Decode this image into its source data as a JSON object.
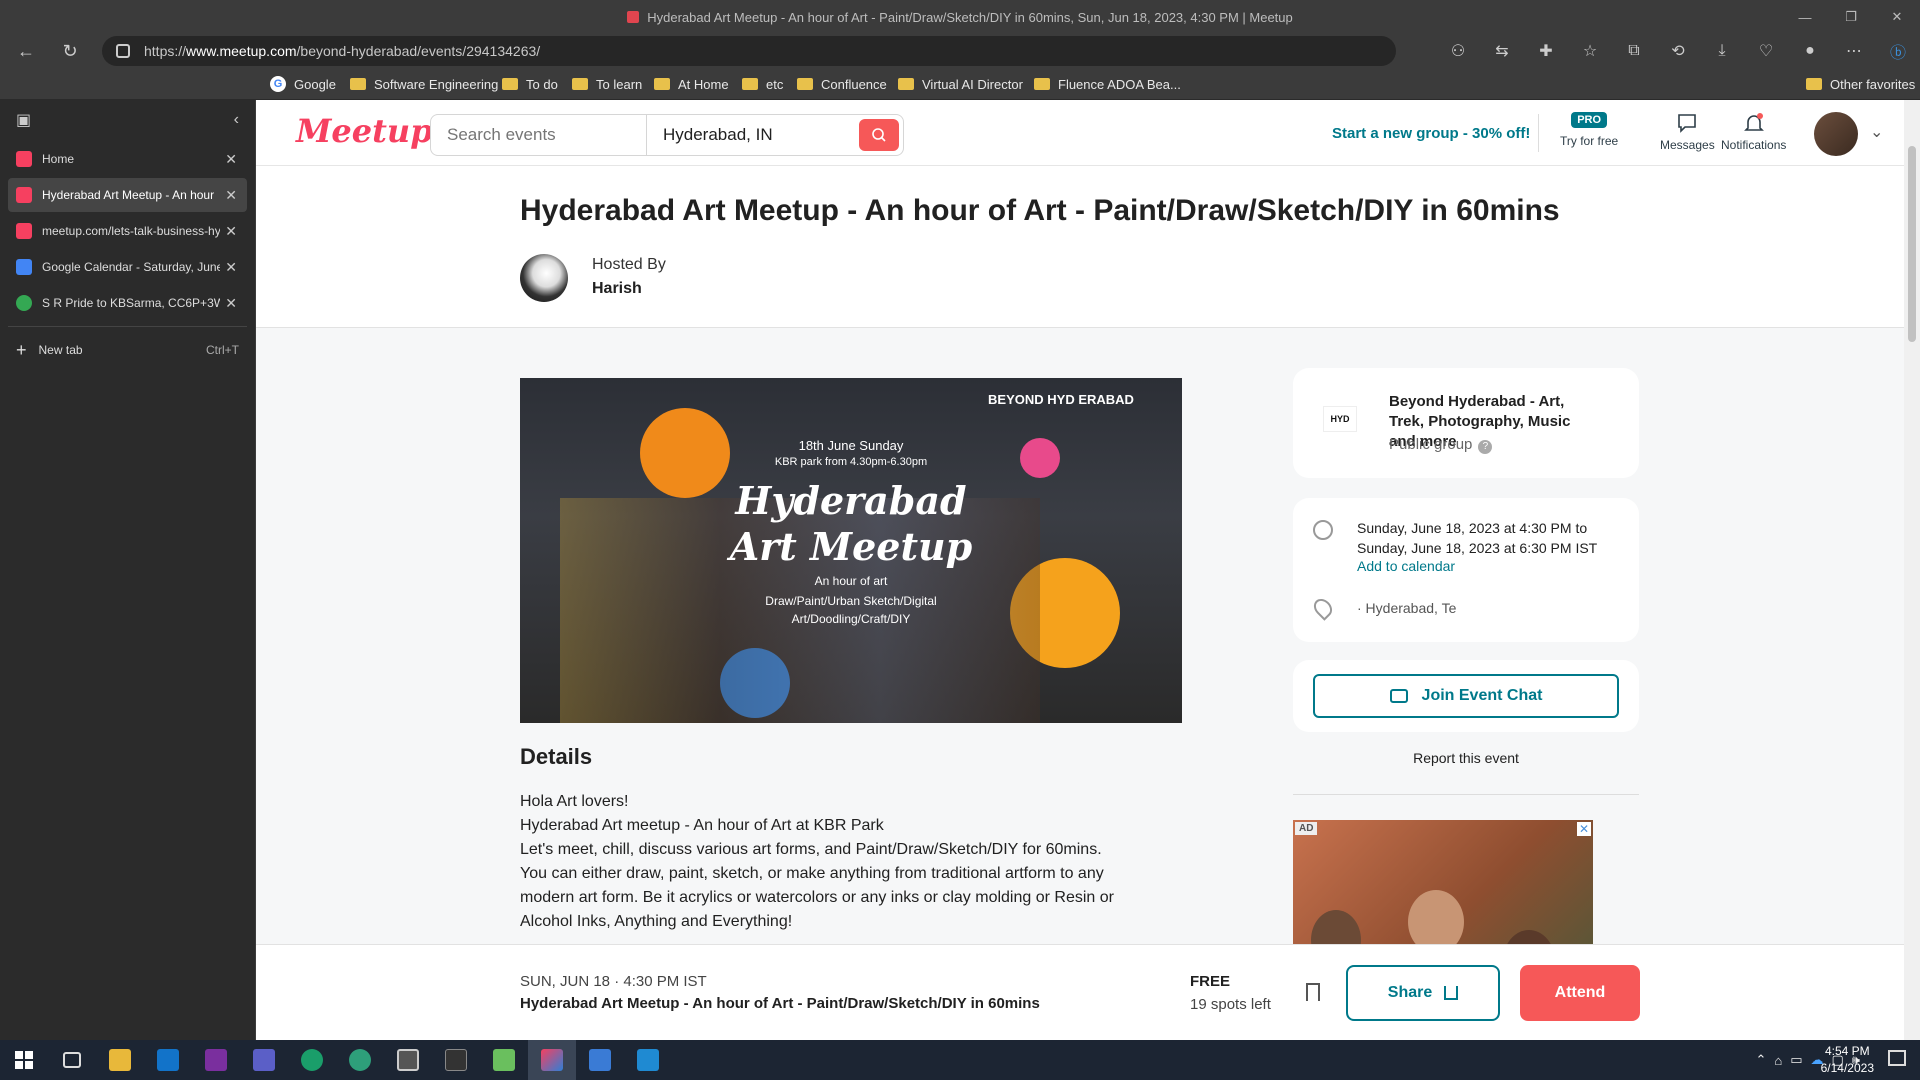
{
  "browser": {
    "window_title": "Hyderabad Art Meetup - An hour of Art - Paint/Draw/Sketch/DIY in 60mins, Sun, Jun 18, 2023, 4:30 PM | Meetup",
    "url_prefix": "https://",
    "url_host": "www.meetup.com",
    "url_path": "/beyond-hyderabad/events/294134263/",
    "bookmarks": [
      "Google",
      "Software Engineering",
      "To do",
      "To learn",
      "At Home",
      "etc",
      "Confluence",
      "Virtual AI Director",
      "Fluence ADOA Bea...",
      "Other favorites"
    ]
  },
  "tabs": {
    "items": [
      {
        "label": "Home",
        "icon": "meetup-icon",
        "color": "#f64060"
      },
      {
        "label": "Hyderabad Art Meetup - An hour",
        "icon": "meetup-icon",
        "color": "#f64060"
      },
      {
        "label": "meetup.com/lets-talk-business-hy",
        "icon": "meetup-icon",
        "color": "#f64060"
      },
      {
        "label": "Google Calendar - Saturday, June",
        "icon": "calendar-icon",
        "color": "#4285f4"
      },
      {
        "label": "S R Pride to KBSarma, CC6P+3W5",
        "icon": "maps-icon",
        "color": "#34a853"
      }
    ],
    "new_tab_label": "New tab",
    "new_tab_shortcut": "Ctrl+T"
  },
  "header": {
    "logo": "Meetup",
    "search_placeholder": "Search events",
    "location_value": "Hyderabad, IN",
    "start_group": "Start a new group - 30% off!",
    "pro_badge": "PRO",
    "try_free": "Try for free",
    "messages": "Messages",
    "notifications": "Notifications"
  },
  "event": {
    "title": "Hyderabad Art Meetup - An hour of Art - Paint/Draw/Sketch/DIY in 60mins",
    "hosted_by": "Hosted By",
    "host_name": "Harish",
    "image_text": {
      "brand": "BEYOND HYD ERABAD",
      "date_line": "18th June Sunday",
      "venue_line": "KBR park from 4.30pm-6.30pm",
      "headline1": "Hyderabad",
      "headline2": "Art Meetup",
      "sub1": "An hour of art",
      "sub2": "Draw/Paint/Urban Sketch/Digital",
      "sub3": "Art/Doodling/Craft/DIY"
    },
    "details_heading": "Details",
    "details_lines": [
      "Hola Art lovers!",
      "Hyderabad Art meetup - An hour of Art at KBR Park",
      "Let's meet, chill, discuss various art forms, and Paint/Draw/Sketch/DIY for 60mins.",
      "You can either draw, paint, sketch, or make anything from traditional artform to any",
      "modern art form. Be it acrylics or watercolors or any inks or clay molding or Resin or",
      "Alcohol Inks, Anything and Everything!"
    ]
  },
  "group_card": {
    "logo_text": "HYD",
    "name": "Beyond Hyderabad - Art, Trek, Photography, Music and more",
    "type": "Public group"
  },
  "time_card": {
    "line1": "Sunday, June 18, 2023 at 4:30 PM to",
    "line2": "Sunday, June 18, 2023 at 6:30 PM IST",
    "add_calendar": "Add to calendar",
    "location": "· Hyderabad, Te"
  },
  "join_chat": "Join Event Chat",
  "report": "Report this event",
  "ad_label": "AD",
  "bottom_bar": {
    "date": "SUN, JUN 18 · 4:30 PM IST",
    "title": "Hyderabad Art Meetup - An hour of Art - Paint/Draw/Sketch/DIY in 60mins",
    "price": "FREE",
    "spots": "19 spots left",
    "share": "Share",
    "attend": "Attend"
  },
  "taskbar": {
    "time": "4:54 PM",
    "date": "6/14/2023"
  },
  "colors": {
    "meetup_red": "#f64060",
    "teal": "#00798a",
    "attend": "#f65858"
  }
}
